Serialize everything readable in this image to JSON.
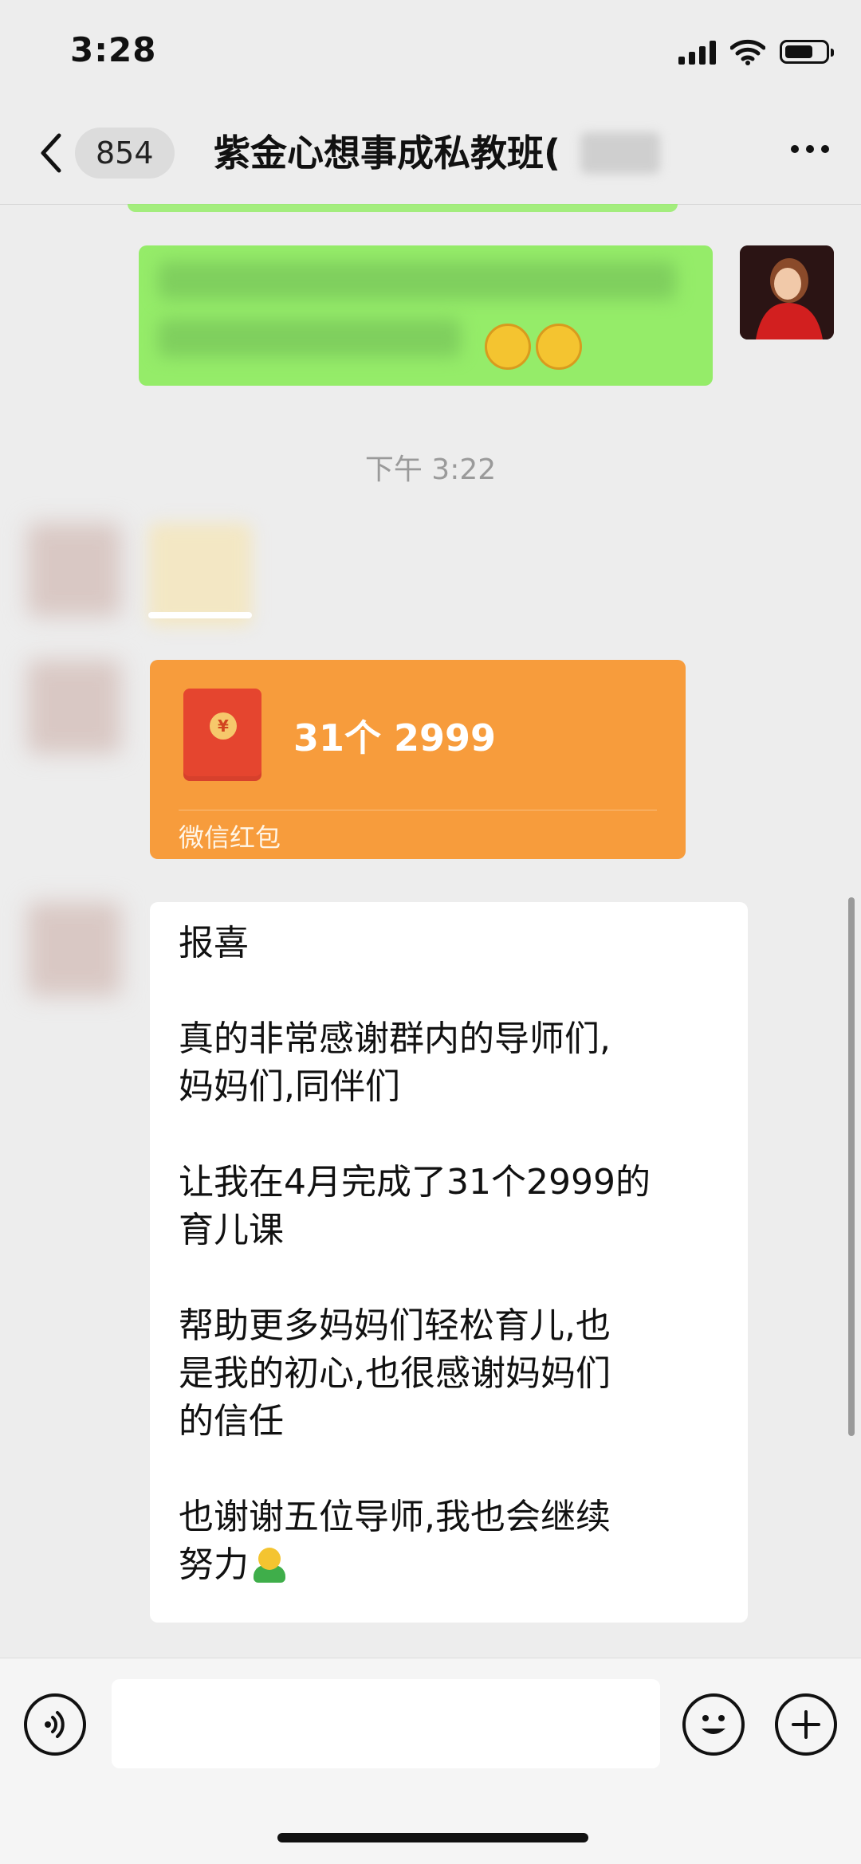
{
  "status_bar": {
    "time": "3:28"
  },
  "nav": {
    "unread_count": "854",
    "title": "紫金心想事成私教班("
  },
  "messages": {
    "timestamp": "下午 3:22",
    "red_packet": {
      "title": "31个 2999",
      "label": "微信红包"
    },
    "text_message": {
      "paragraphs": [
        [
          "报喜"
        ],
        [
          "真的非常感谢群内的导师们,",
          "妈妈们,同伴们"
        ],
        [
          "让我在4月完成了31个2999的",
          "育儿课"
        ],
        [
          "帮助更多妈妈们轻松育儿,也",
          "是我的初心,也很感谢妈妈们",
          "的信任"
        ],
        [
          "也谢谢五位导师,我也会继续",
          "努力"
        ]
      ]
    }
  },
  "input_bar": {
    "placeholder": ""
  },
  "icons": {
    "back": "chevron-left-icon",
    "more": "more-icon",
    "voice": "voice-icon",
    "emoji": "emoji-icon",
    "plus": "plus-icon"
  },
  "colors": {
    "self_bubble": "#95ec69",
    "red_packet": "#f79c3c",
    "background": "#ededed"
  }
}
